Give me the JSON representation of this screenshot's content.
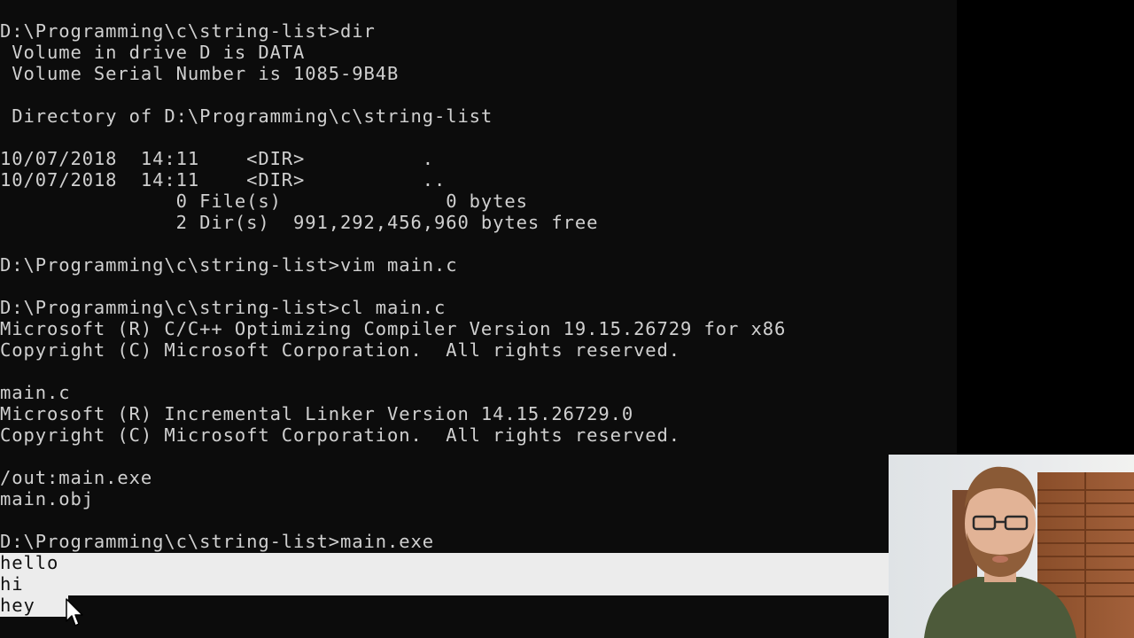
{
  "console": {
    "lines": [
      "D:\\Programming\\c\\string-list>dir",
      " Volume in drive D is DATA",
      " Volume Serial Number is 1085-9B4B",
      "",
      " Directory of D:\\Programming\\c\\string-list",
      "",
      "10/07/2018  14:11    <DIR>          .",
      "10/07/2018  14:11    <DIR>          ..",
      "               0 File(s)              0 bytes",
      "               2 Dir(s)  991,292,456,960 bytes free",
      "",
      "D:\\Programming\\c\\string-list>vim main.c",
      "",
      "D:\\Programming\\c\\string-list>cl main.c",
      "Microsoft (R) C/C++ Optimizing Compiler Version 19.15.26729 for x86",
      "Copyright (C) Microsoft Corporation.  All rights reserved.",
      "",
      "main.c",
      "Microsoft (R) Incremental Linker Version 14.15.26729.0",
      "Copyright (C) Microsoft Corporation.  All rights reserved.",
      "",
      "/out:main.exe",
      "main.obj",
      "",
      "D:\\Programming\\c\\string-list>main.exe"
    ],
    "input_lines": [
      "hello",
      "hi",
      "hey"
    ],
    "colors": {
      "background": "#0c0c0c",
      "text": "#d0d0d0",
      "selection_background": "#ececec",
      "selection_text": "#111111"
    }
  },
  "pointer": {
    "icon": "arrow-cursor-icon"
  },
  "webcam": {
    "icon": "webcam-person-icon"
  }
}
